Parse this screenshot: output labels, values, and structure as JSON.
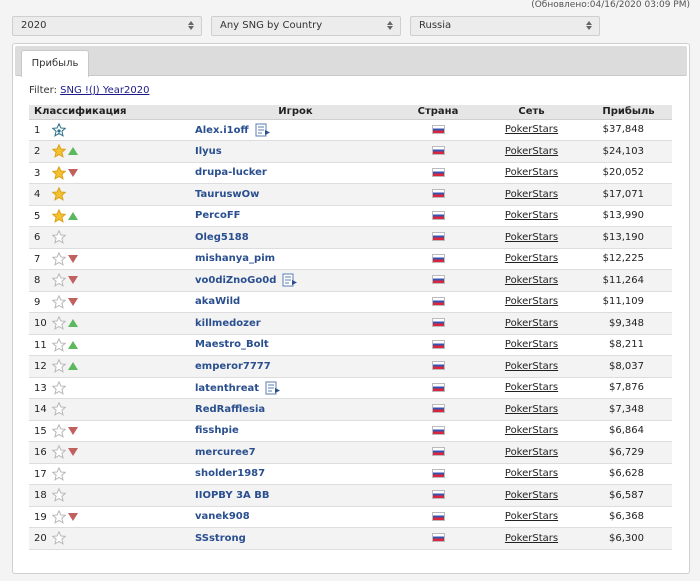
{
  "updated": "(Обновлено:04/16/2020 03:09 PM)",
  "selectors": {
    "year": "2020",
    "type": "Any SNG by Country",
    "country": "Russia"
  },
  "tab_label": "Прибыль",
  "filter": {
    "label": "Filter:",
    "link": "SNG !(J) Year2020"
  },
  "table": {
    "headers": {
      "rank": "Классификация",
      "player": "Игрок",
      "country": "Страна",
      "network": "Сеть",
      "profit": "Прибыль"
    },
    "rows": [
      {
        "rank": "1",
        "star": "blue",
        "trend": "none",
        "player": "Alex.i1off",
        "note": true,
        "network": "PokerStars",
        "profit": "$37,848"
      },
      {
        "rank": "2",
        "star": "gold",
        "trend": "up",
        "player": "Ilyus",
        "note": false,
        "network": "PokerStars",
        "profit": "$24,103"
      },
      {
        "rank": "3",
        "star": "gold",
        "trend": "down",
        "player": "drupa-lucker",
        "note": false,
        "network": "PokerStars",
        "profit": "$20,052"
      },
      {
        "rank": "4",
        "star": "gold",
        "trend": "none",
        "player": "TauruswOw",
        "note": false,
        "network": "PokerStars",
        "profit": "$17,071"
      },
      {
        "rank": "5",
        "star": "gold",
        "trend": "up",
        "player": "PercoFF",
        "note": false,
        "network": "PokerStars",
        "profit": "$13,990"
      },
      {
        "rank": "6",
        "star": "empty",
        "trend": "none",
        "player": "Oleg5188",
        "note": false,
        "network": "PokerStars",
        "profit": "$13,190"
      },
      {
        "rank": "7",
        "star": "empty",
        "trend": "down",
        "player": "mishanya_pim",
        "note": false,
        "network": "PokerStars",
        "profit": "$12,225"
      },
      {
        "rank": "8",
        "star": "empty",
        "trend": "down",
        "player": "vo0diZnoGo0d",
        "note": true,
        "network": "PokerStars",
        "profit": "$11,264"
      },
      {
        "rank": "9",
        "star": "empty",
        "trend": "down",
        "player": "akaWild",
        "note": false,
        "network": "PokerStars",
        "profit": "$11,109"
      },
      {
        "rank": "10",
        "star": "empty",
        "trend": "up",
        "player": "killmedozer",
        "note": false,
        "network": "PokerStars",
        "profit": "$9,348"
      },
      {
        "rank": "11",
        "star": "empty",
        "trend": "up",
        "player": "Maestro_Bolt",
        "note": false,
        "network": "PokerStars",
        "profit": "$8,211"
      },
      {
        "rank": "12",
        "star": "empty",
        "trend": "up",
        "player": "emperor7777",
        "note": false,
        "network": "PokerStars",
        "profit": "$8,037"
      },
      {
        "rank": "13",
        "star": "empty",
        "trend": "none",
        "player": "latenthreat",
        "note": true,
        "network": "PokerStars",
        "profit": "$7,876"
      },
      {
        "rank": "14",
        "star": "empty",
        "trend": "none",
        "player": "RedRafflesia",
        "note": false,
        "network": "PokerStars",
        "profit": "$7,348"
      },
      {
        "rank": "15",
        "star": "empty",
        "trend": "down",
        "player": "fisshpie",
        "note": false,
        "network": "PokerStars",
        "profit": "$6,864"
      },
      {
        "rank": "16",
        "star": "empty",
        "trend": "down",
        "player": "mercuree7",
        "note": false,
        "network": "PokerStars",
        "profit": "$6,729"
      },
      {
        "rank": "17",
        "star": "empty",
        "trend": "none",
        "player": "sholder1987",
        "note": false,
        "network": "PokerStars",
        "profit": "$6,628"
      },
      {
        "rank": "18",
        "star": "empty",
        "trend": "none",
        "player": "IIOPBY 3A BB",
        "note": false,
        "network": "PokerStars",
        "profit": "$6,587"
      },
      {
        "rank": "19",
        "star": "empty",
        "trend": "down",
        "player": "vanek908",
        "note": false,
        "network": "PokerStars",
        "profit": "$6,368"
      },
      {
        "rank": "20",
        "star": "empty",
        "trend": "none",
        "player": "SSstrong",
        "note": false,
        "network": "PokerStars",
        "profit": "$6,300"
      }
    ]
  },
  "colors": {
    "star_gold": "#f5c12e",
    "star_blue_outline": "#2a6e8a",
    "trend_up": "#5cb85c",
    "trend_down": "#c0605f",
    "player_link": "#2a4f8f"
  }
}
